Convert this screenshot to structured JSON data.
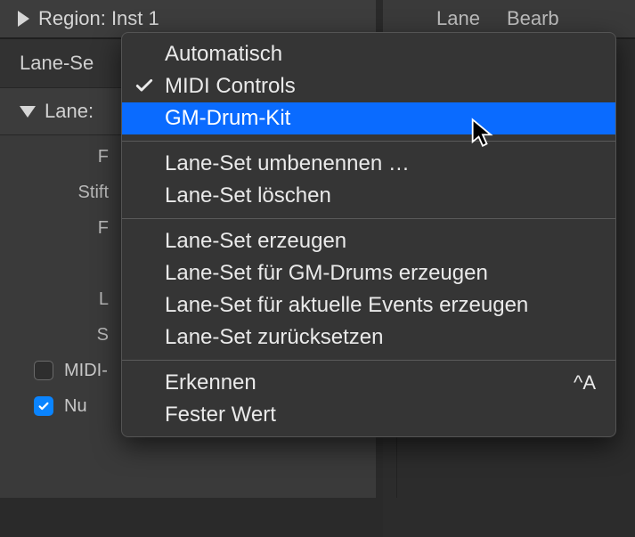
{
  "region": {
    "label": "Region: Inst 1"
  },
  "lane_set_label": "Lane-Se",
  "lane_label": "Lane:",
  "side_rows": [
    {
      "label": "F"
    },
    {
      "label": "Stift"
    },
    {
      "label": "F"
    },
    {
      "label": ""
    },
    {
      "label": "L"
    },
    {
      "label": "S"
    }
  ],
  "checks": [
    {
      "label": "MIDI-",
      "checked": false
    },
    {
      "label": "Nu",
      "checked": true
    }
  ],
  "tabs": [
    {
      "label": "Lane"
    },
    {
      "label": "Bearb"
    }
  ],
  "menu": {
    "groups": [
      [
        {
          "label": "Automatisch",
          "checked": false,
          "highlight": false
        },
        {
          "label": "MIDI Controls",
          "checked": true,
          "highlight": false
        },
        {
          "label": "GM-Drum-Kit",
          "checked": false,
          "highlight": true
        }
      ],
      [
        {
          "label": "Lane-Set umbenennen …"
        },
        {
          "label": "Lane-Set löschen"
        }
      ],
      [
        {
          "label": "Lane-Set erzeugen"
        },
        {
          "label": "Lane-Set für GM-Drums erzeugen"
        },
        {
          "label": "Lane-Set für aktuelle Events erzeugen"
        },
        {
          "label": "Lane-Set zurücksetzen"
        }
      ],
      [
        {
          "label": "Erkennen",
          "shortcut": "^A"
        },
        {
          "label": "Fester Wert"
        }
      ]
    ]
  }
}
